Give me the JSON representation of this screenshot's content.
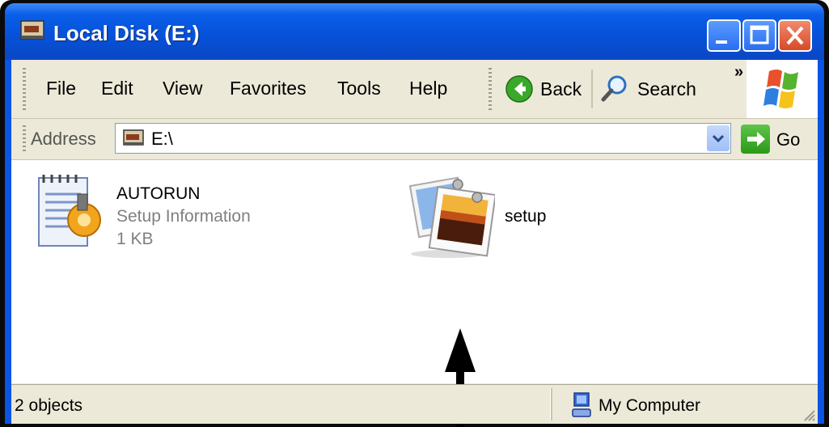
{
  "window": {
    "title": "Local Disk (E:)"
  },
  "menu": {
    "items": [
      "File",
      "Edit",
      "View",
      "Favorites",
      "Tools",
      "Help"
    ]
  },
  "toolbar": {
    "back_label": "Back",
    "search_label": "Search",
    "overflow": "»"
  },
  "address": {
    "label": "Address",
    "value": "E:\\",
    "go_label": "Go"
  },
  "files": [
    {
      "name": "AUTORUN",
      "type": "Setup Information",
      "size": "1 KB",
      "icon": "setup-information-icon"
    },
    {
      "name": "setup",
      "icon": "image-file-icon"
    }
  ],
  "status": {
    "objects": "2 objects",
    "location": "My Computer"
  },
  "colors": {
    "titlebar": "#0a5ee8",
    "chrome": "#ece9d8",
    "close": "#d84a28",
    "go": "#2a9a18"
  }
}
